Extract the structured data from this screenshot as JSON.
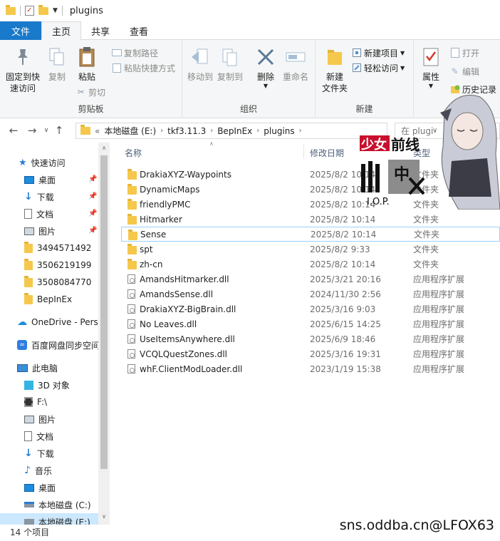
{
  "window": {
    "title": "plugins"
  },
  "tabs": [
    {
      "label": "文件"
    },
    {
      "label": "主页"
    },
    {
      "label": "共享"
    },
    {
      "label": "查看"
    }
  ],
  "ribbon": {
    "clipboard": {
      "pin_label": "固定到快\n速访问",
      "copy_label": "复制",
      "paste_label": "粘贴",
      "copy_path": "复制路径",
      "paste_shortcut": "粘贴快捷方式",
      "cut": "剪切",
      "group": "剪贴板"
    },
    "organize": {
      "move_to": "移动到",
      "copy_to": "复制到",
      "delete": "删除",
      "rename": "重命名",
      "group": "组织"
    },
    "new": {
      "new_folder": "新建\n文件夹",
      "new_item": "新建项目",
      "easy_access": "轻松访问",
      "group": "新建"
    },
    "open": {
      "properties": "属性",
      "open": "打开",
      "edit": "编辑",
      "history": "历史记录"
    }
  },
  "address": {
    "prefix": "«",
    "crumbs": [
      "本地磁盘 (E:)",
      "tkf3.11.3",
      "BepInEx",
      "plugins"
    ],
    "search_placeholder": "在 plugi"
  },
  "nav": {
    "quick_access": "快速访问",
    "items": [
      {
        "label": "桌面",
        "pinned": true
      },
      {
        "label": "下载",
        "pinned": true
      },
      {
        "label": "文档",
        "pinned": true
      },
      {
        "label": "图片",
        "pinned": true
      },
      {
        "label": "3494571492"
      },
      {
        "label": "3506219199"
      },
      {
        "label": "3508084770"
      },
      {
        "label": "BepInEx"
      }
    ],
    "onedrive": "OneDrive - Pers",
    "baidu": "百度网盘同步空间",
    "this_pc": "此电脑",
    "pc_items": [
      {
        "label": "3D 对象"
      },
      {
        "label": "F:\\"
      },
      {
        "label": "图片"
      },
      {
        "label": "文档"
      },
      {
        "label": "下载"
      },
      {
        "label": "音乐"
      },
      {
        "label": "桌面"
      },
      {
        "label": "本地磁盘 (C:)"
      },
      {
        "label": "本地磁盘 (E:)"
      }
    ]
  },
  "columns": {
    "name": "名称",
    "modified": "修改日期",
    "type": "类型"
  },
  "files": [
    {
      "name": "DrakiaXYZ-Waypoints",
      "date": "2025/8/2 10:14",
      "type": "文件夹",
      "kind": "folder"
    },
    {
      "name": "DynamicMaps",
      "date": "2025/8/2 10:14",
      "type": "文件夹",
      "kind": "folder"
    },
    {
      "name": "friendlyPMC",
      "date": "2025/8/2 10:14",
      "type": "文件夹",
      "kind": "folder"
    },
    {
      "name": "Hitmarker",
      "date": "2025/8/2 10:14",
      "type": "文件夹",
      "kind": "folder"
    },
    {
      "name": "Sense",
      "date": "2025/8/2 10:14",
      "type": "文件夹",
      "kind": "folder",
      "selected": true
    },
    {
      "name": "spt",
      "date": "2025/8/2 9:33",
      "type": "文件夹",
      "kind": "folder"
    },
    {
      "name": "zh-cn",
      "date": "2025/8/2 10:14",
      "type": "文件夹",
      "kind": "folder"
    },
    {
      "name": "AmandsHitmarker.dll",
      "date": "2025/3/21 20:16",
      "type": "应用程序扩展",
      "kind": "dll"
    },
    {
      "name": "AmandsSense.dll",
      "date": "2024/11/30 2:56",
      "type": "应用程序扩展",
      "kind": "dll"
    },
    {
      "name": "DrakiaXYZ-BigBrain.dll",
      "date": "2025/3/16 9:03",
      "type": "应用程序扩展",
      "kind": "dll"
    },
    {
      "name": "No Leaves.dll",
      "date": "2025/6/15 14:25",
      "type": "应用程序扩展",
      "kind": "dll"
    },
    {
      "name": "UseItemsAnywhere.dll",
      "date": "2025/6/9 18:46",
      "type": "应用程序扩展",
      "kind": "dll"
    },
    {
      "name": "VCQLQuestZones.dll",
      "date": "2025/3/16 19:31",
      "type": "应用程序扩展",
      "kind": "dll"
    },
    {
      "name": "whF.ClientModLoader.dll",
      "date": "2023/1/19 15:38",
      "type": "应用程序扩展",
      "kind": "dll"
    }
  ],
  "status": {
    "count": "14 个项目"
  },
  "watermark": "sns.oddba.cn@LFOX63",
  "colors": {
    "accent": "#1979ca",
    "folder": "#f5c84c",
    "selection": "#cce8ff"
  }
}
